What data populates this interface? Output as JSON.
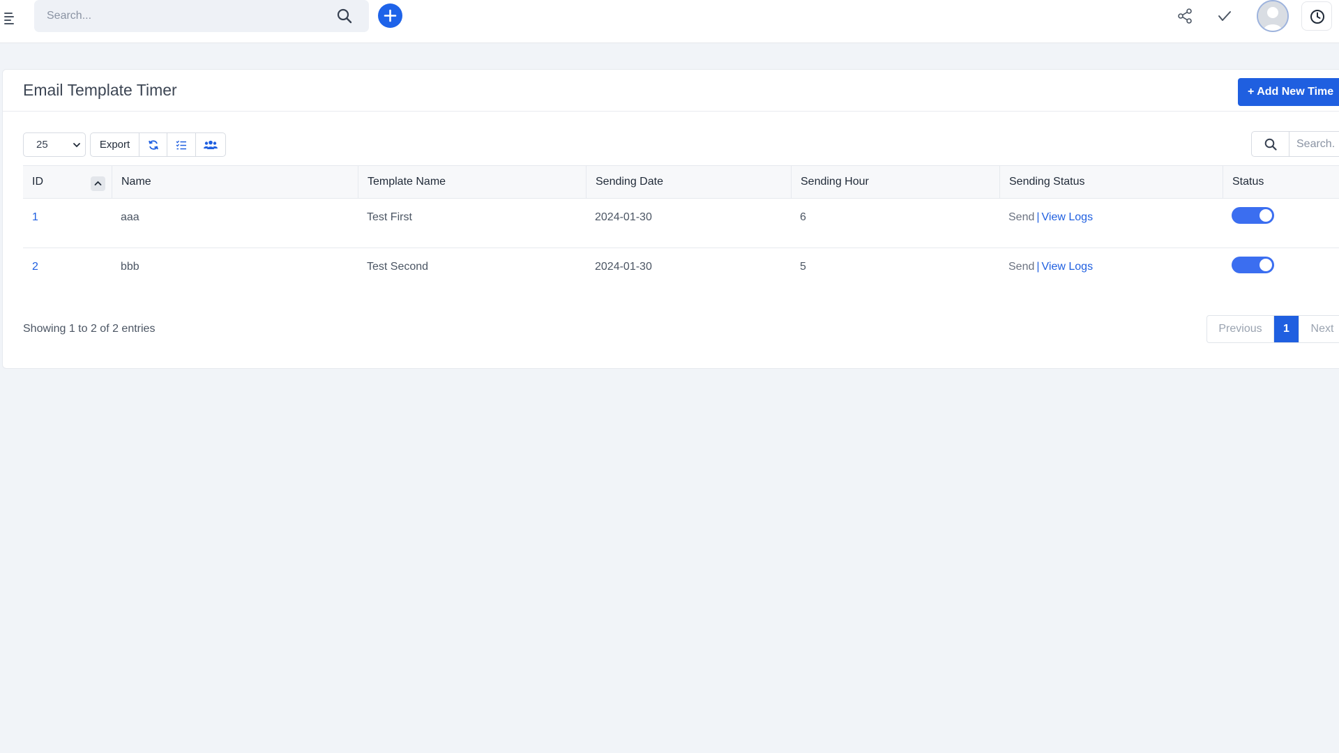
{
  "topbar": {
    "search_placeholder": "Search...",
    "icons": [
      "menu-icon",
      "search-icon",
      "plus-icon",
      "share-icon",
      "check-icon",
      "avatar",
      "clock-icon"
    ]
  },
  "page": {
    "title": "Email Template Timer",
    "add_button_label": "+ Add New Time"
  },
  "toolbar": {
    "page_size": "25",
    "export_label": "Export",
    "search_placeholder": "Search."
  },
  "table": {
    "columns": [
      "ID",
      "Name",
      "Template Name",
      "Sending Date",
      "Sending Hour",
      "Sending Status",
      "Status"
    ],
    "rows": [
      {
        "id": "1",
        "name": "aaa",
        "template": "Test First",
        "date": "2024-01-30",
        "hour": "6",
        "send": "Send",
        "sep": "|",
        "logs": "View Logs",
        "status_on": true
      },
      {
        "id": "2",
        "name": "bbb",
        "template": "Test Second",
        "date": "2024-01-30",
        "hour": "5",
        "send": "Send",
        "sep": "|",
        "logs": "View Logs",
        "status_on": true
      }
    ]
  },
  "footer": {
    "showing": "Showing 1 to 2 of 2 entries",
    "previous": "Previous",
    "current_page": "1",
    "next": "Next"
  },
  "colors": {
    "accent": "#1f5fe0",
    "toggle_on": "#3b6ef0",
    "background": "#f1f4f8"
  }
}
